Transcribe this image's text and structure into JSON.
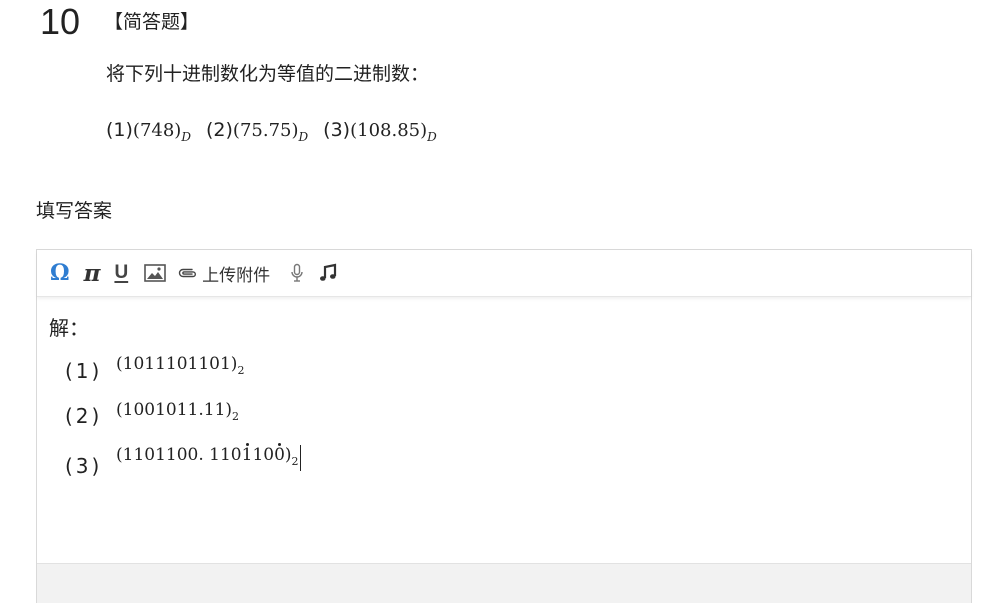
{
  "question": {
    "number": "10",
    "type_label": "【简答题】",
    "prompt": "将下列十进制数化为等值的二进制数：",
    "items": [
      {
        "label": "(1)",
        "value": "(748)",
        "subscript": "D"
      },
      {
        "label": "(2)",
        "value": "(75.75)",
        "subscript": "D"
      },
      {
        "label": "(3)",
        "value": "(108.85)",
        "subscript": "D"
      }
    ]
  },
  "answer_section": {
    "label": "填写答案"
  },
  "toolbar": {
    "omega_label": "Ω",
    "pi_label": "π",
    "underline_label": "U",
    "upload_label": "上传附件",
    "icons": [
      "omega-icon",
      "pi-icon",
      "underline-icon",
      "image-icon",
      "paperclip-icon",
      "microphone-icon",
      "music-icon"
    ]
  },
  "answer": {
    "heading": "解：",
    "lines": [
      {
        "label": "(1)",
        "value": "(1011101101)",
        "subscript": "2"
      },
      {
        "label": "(2)",
        "value": "(1001011.11)",
        "subscript": "2"
      },
      {
        "label": "(3)",
        "value_prefix": "(1101100. 110",
        "dot_digit_1": "1",
        "value_middle": "10",
        "dot_digit_2": "0",
        "value_suffix": ")",
        "subscript": "2"
      }
    ]
  },
  "colors": {
    "accent": "#2f7dd1",
    "text": "#222222",
    "border": "#d9d9d9",
    "footer_bg": "#f2f2f2"
  }
}
